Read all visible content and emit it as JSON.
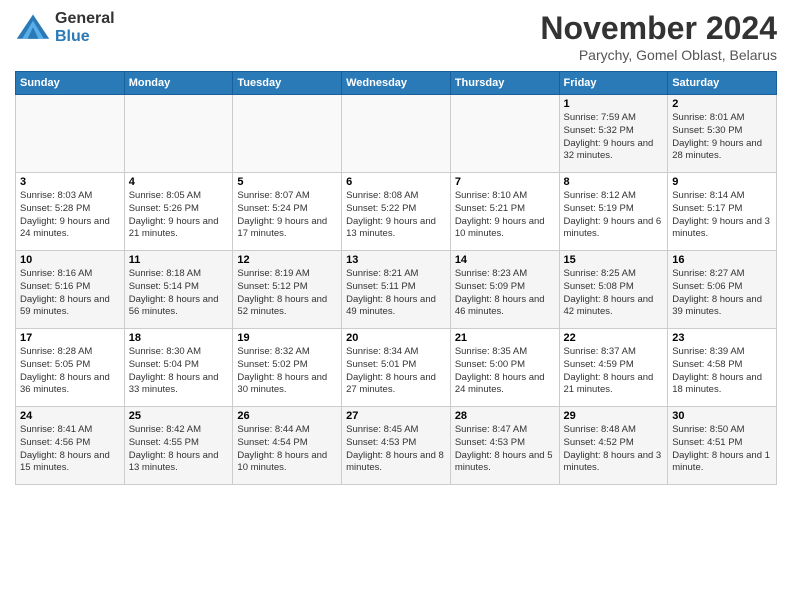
{
  "logo": {
    "general": "General",
    "blue": "Blue"
  },
  "title": "November 2024",
  "location": "Parychy, Gomel Oblast, Belarus",
  "days_header": [
    "Sunday",
    "Monday",
    "Tuesday",
    "Wednesday",
    "Thursday",
    "Friday",
    "Saturday"
  ],
  "weeks": [
    [
      {
        "day": "",
        "info": ""
      },
      {
        "day": "",
        "info": ""
      },
      {
        "day": "",
        "info": ""
      },
      {
        "day": "",
        "info": ""
      },
      {
        "day": "",
        "info": ""
      },
      {
        "day": "1",
        "info": "Sunrise: 7:59 AM\nSunset: 5:32 PM\nDaylight: 9 hours and 32 minutes."
      },
      {
        "day": "2",
        "info": "Sunrise: 8:01 AM\nSunset: 5:30 PM\nDaylight: 9 hours and 28 minutes."
      }
    ],
    [
      {
        "day": "3",
        "info": "Sunrise: 8:03 AM\nSunset: 5:28 PM\nDaylight: 9 hours and 24 minutes."
      },
      {
        "day": "4",
        "info": "Sunrise: 8:05 AM\nSunset: 5:26 PM\nDaylight: 9 hours and 21 minutes."
      },
      {
        "day": "5",
        "info": "Sunrise: 8:07 AM\nSunset: 5:24 PM\nDaylight: 9 hours and 17 minutes."
      },
      {
        "day": "6",
        "info": "Sunrise: 8:08 AM\nSunset: 5:22 PM\nDaylight: 9 hours and 13 minutes."
      },
      {
        "day": "7",
        "info": "Sunrise: 8:10 AM\nSunset: 5:21 PM\nDaylight: 9 hours and 10 minutes."
      },
      {
        "day": "8",
        "info": "Sunrise: 8:12 AM\nSunset: 5:19 PM\nDaylight: 9 hours and 6 minutes."
      },
      {
        "day": "9",
        "info": "Sunrise: 8:14 AM\nSunset: 5:17 PM\nDaylight: 9 hours and 3 minutes."
      }
    ],
    [
      {
        "day": "10",
        "info": "Sunrise: 8:16 AM\nSunset: 5:16 PM\nDaylight: 8 hours and 59 minutes."
      },
      {
        "day": "11",
        "info": "Sunrise: 8:18 AM\nSunset: 5:14 PM\nDaylight: 8 hours and 56 minutes."
      },
      {
        "day": "12",
        "info": "Sunrise: 8:19 AM\nSunset: 5:12 PM\nDaylight: 8 hours and 52 minutes."
      },
      {
        "day": "13",
        "info": "Sunrise: 8:21 AM\nSunset: 5:11 PM\nDaylight: 8 hours and 49 minutes."
      },
      {
        "day": "14",
        "info": "Sunrise: 8:23 AM\nSunset: 5:09 PM\nDaylight: 8 hours and 46 minutes."
      },
      {
        "day": "15",
        "info": "Sunrise: 8:25 AM\nSunset: 5:08 PM\nDaylight: 8 hours and 42 minutes."
      },
      {
        "day": "16",
        "info": "Sunrise: 8:27 AM\nSunset: 5:06 PM\nDaylight: 8 hours and 39 minutes."
      }
    ],
    [
      {
        "day": "17",
        "info": "Sunrise: 8:28 AM\nSunset: 5:05 PM\nDaylight: 8 hours and 36 minutes."
      },
      {
        "day": "18",
        "info": "Sunrise: 8:30 AM\nSunset: 5:04 PM\nDaylight: 8 hours and 33 minutes."
      },
      {
        "day": "19",
        "info": "Sunrise: 8:32 AM\nSunset: 5:02 PM\nDaylight: 8 hours and 30 minutes."
      },
      {
        "day": "20",
        "info": "Sunrise: 8:34 AM\nSunset: 5:01 PM\nDaylight: 8 hours and 27 minutes."
      },
      {
        "day": "21",
        "info": "Sunrise: 8:35 AM\nSunset: 5:00 PM\nDaylight: 8 hours and 24 minutes."
      },
      {
        "day": "22",
        "info": "Sunrise: 8:37 AM\nSunset: 4:59 PM\nDaylight: 8 hours and 21 minutes."
      },
      {
        "day": "23",
        "info": "Sunrise: 8:39 AM\nSunset: 4:58 PM\nDaylight: 8 hours and 18 minutes."
      }
    ],
    [
      {
        "day": "24",
        "info": "Sunrise: 8:41 AM\nSunset: 4:56 PM\nDaylight: 8 hours and 15 minutes."
      },
      {
        "day": "25",
        "info": "Sunrise: 8:42 AM\nSunset: 4:55 PM\nDaylight: 8 hours and 13 minutes."
      },
      {
        "day": "26",
        "info": "Sunrise: 8:44 AM\nSunset: 4:54 PM\nDaylight: 8 hours and 10 minutes."
      },
      {
        "day": "27",
        "info": "Sunrise: 8:45 AM\nSunset: 4:53 PM\nDaylight: 8 hours and 8 minutes."
      },
      {
        "day": "28",
        "info": "Sunrise: 8:47 AM\nSunset: 4:53 PM\nDaylight: 8 hours and 5 minutes."
      },
      {
        "day": "29",
        "info": "Sunrise: 8:48 AM\nSunset: 4:52 PM\nDaylight: 8 hours and 3 minutes."
      },
      {
        "day": "30",
        "info": "Sunrise: 8:50 AM\nSunset: 4:51 PM\nDaylight: 8 hours and 1 minute."
      }
    ]
  ]
}
